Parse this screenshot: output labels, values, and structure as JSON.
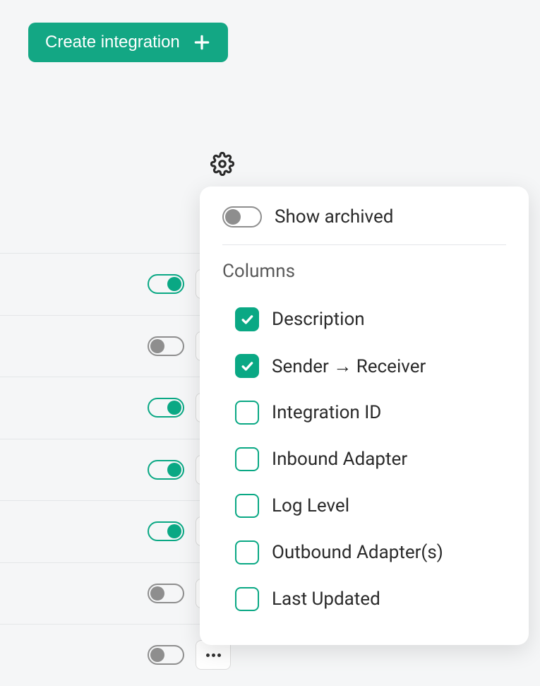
{
  "create_button_label": "Create integration",
  "popover": {
    "show_archived_label": "Show archived",
    "show_archived_on": false,
    "columns_heading": "Columns",
    "columns": [
      {
        "label": "Description",
        "checked": true
      },
      {
        "label": "Sender → Receiver",
        "checked": true
      },
      {
        "label": "Integration ID",
        "checked": false
      },
      {
        "label": "Inbound Adapter",
        "checked": false
      },
      {
        "label": "Log Level",
        "checked": false
      },
      {
        "label": "Outbound Adapter(s)",
        "checked": false
      },
      {
        "label": "Last Updated",
        "checked": false
      }
    ]
  },
  "rows": [
    {
      "toggle_on": true
    },
    {
      "toggle_on": false
    },
    {
      "toggle_on": true
    },
    {
      "toggle_on": true
    },
    {
      "toggle_on": true
    },
    {
      "toggle_on": false
    },
    {
      "toggle_on": false
    }
  ]
}
